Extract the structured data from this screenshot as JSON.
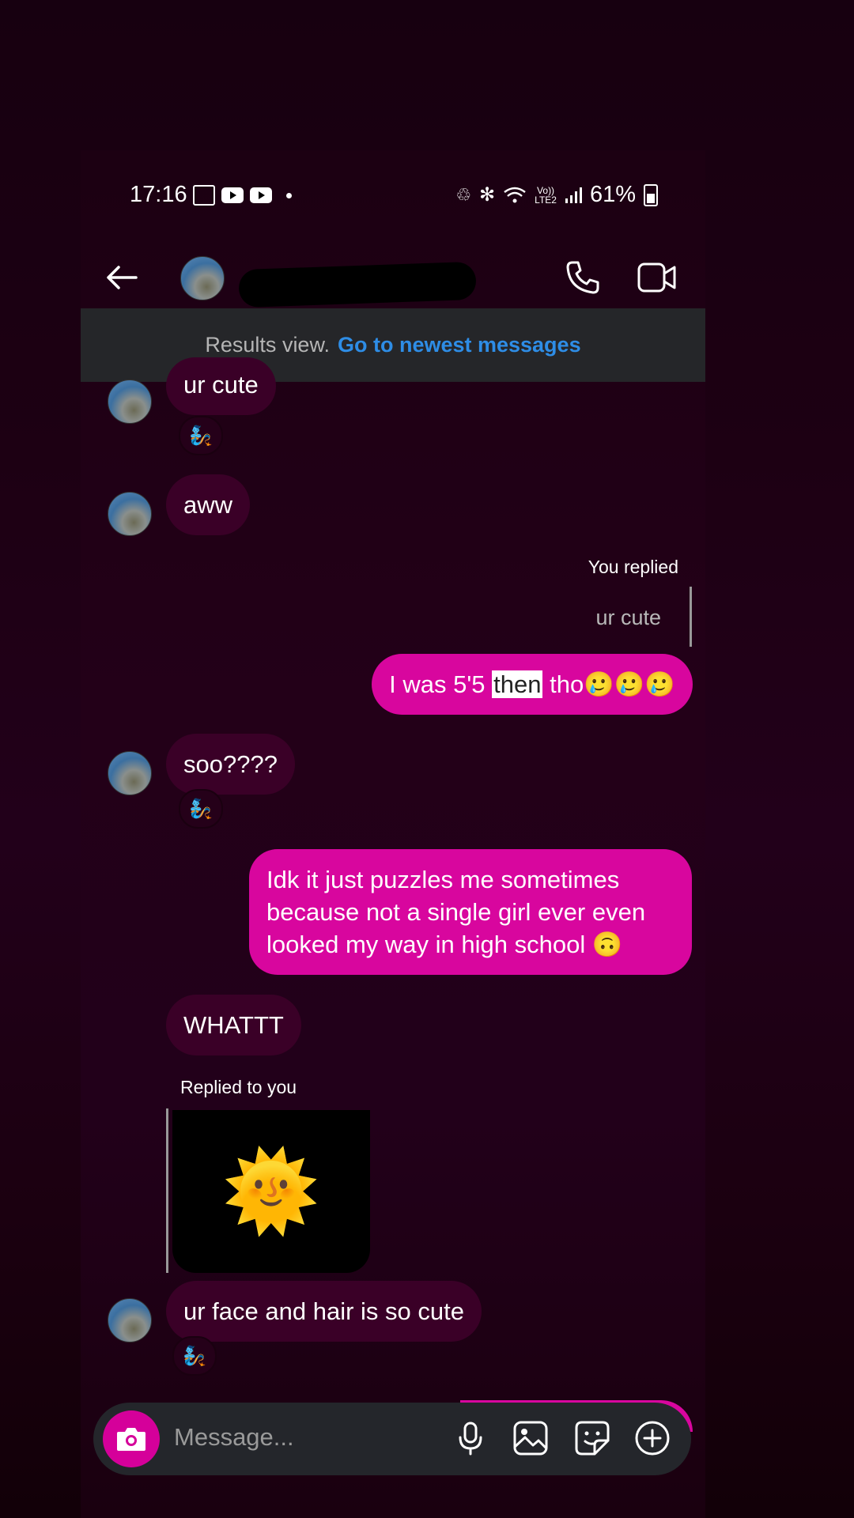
{
  "status_bar": {
    "time": "17:16",
    "battery": "61%"
  },
  "banner": {
    "text": "Results view.",
    "link": "Go to newest messages"
  },
  "messages": [
    {
      "text": "ur cute",
      "reaction": "🧞"
    },
    {
      "text": "aww"
    },
    {
      "label": "You replied",
      "quote": "ur cute"
    },
    {
      "text_before": "I was 5'5 ",
      "highlight": "then",
      "text_after": " tho🥲🥲🥲"
    },
    {
      "text": "soo????",
      "reaction": "🧞"
    },
    {
      "text": "Idk it just puzzles me sometimes because not a single girl ever even looked my way in high school 🙃"
    },
    {
      "text": "WHATTT"
    },
    {
      "label": "Replied to you",
      "image_emoji": "🌞"
    },
    {
      "text": "ur face and hair is so cute",
      "reaction": "🧞"
    }
  ],
  "input": {
    "placeholder": "Message..."
  },
  "icons": {
    "back": "back-arrow-icon",
    "call": "phone-icon",
    "video": "video-camera-icon",
    "camera": "camera-icon",
    "mic": "microphone-icon",
    "gallery": "image-icon",
    "sticker": "sticker-icon",
    "plus": "plus-circle-icon"
  },
  "colors": {
    "accent": "#d8069e",
    "link": "#2e8de6",
    "incoming": "#3a0027"
  }
}
